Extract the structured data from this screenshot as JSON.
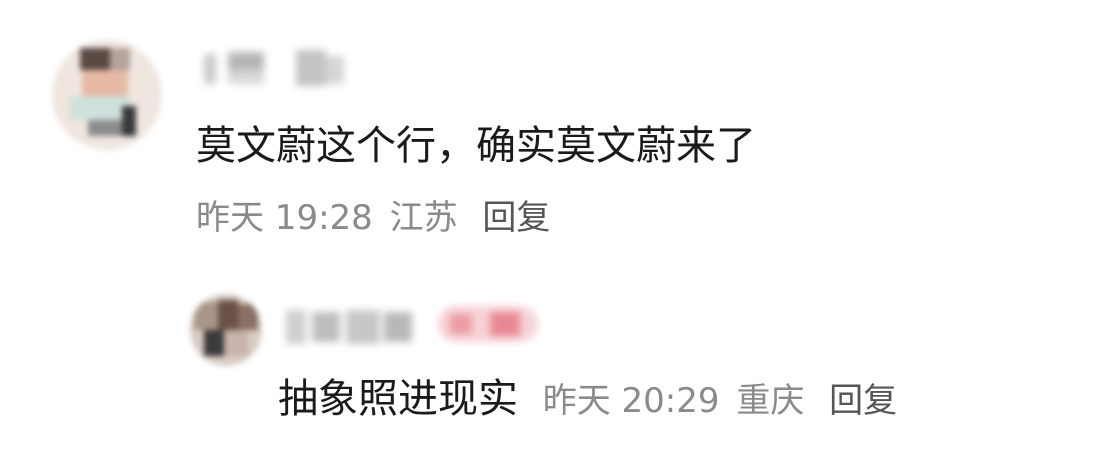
{
  "comments": [
    {
      "text": "莫文蔚这个行，确实莫文蔚来了",
      "time": "昨天 19:28",
      "location": "江苏",
      "reply_label": "回复"
    },
    {
      "text": "抽象照进现实",
      "time": "昨天 20:29",
      "location": "重庆",
      "reply_label": "回复"
    }
  ]
}
